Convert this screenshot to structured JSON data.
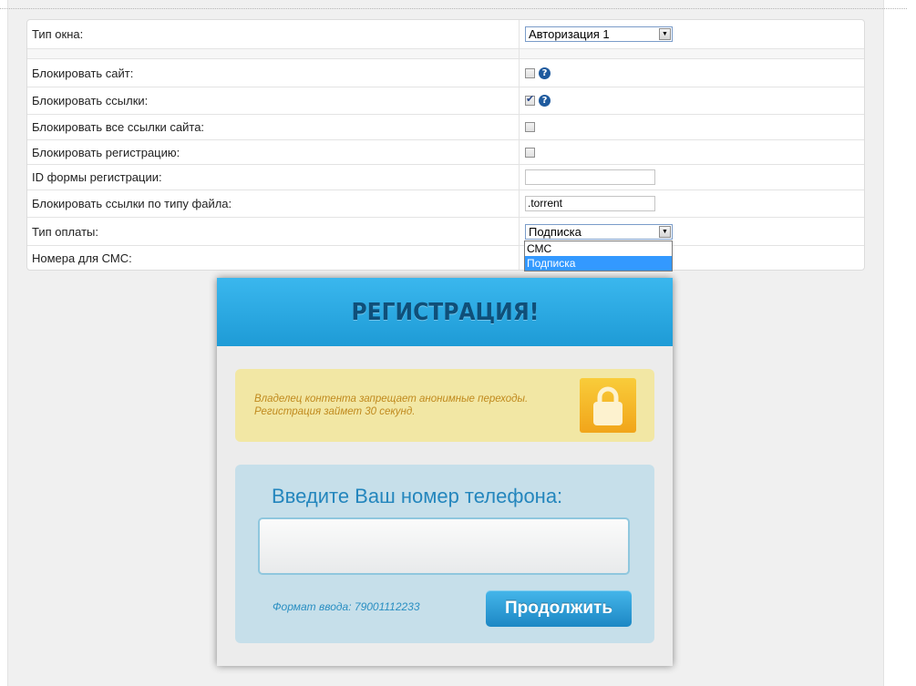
{
  "settings": {
    "rows": {
      "window_type": {
        "label": "Тип окна:",
        "value": "Авторизация 1"
      },
      "block_site": {
        "label": "Блокировать сайт:",
        "checked": false
      },
      "block_links": {
        "label": "Блокировать ссылки:",
        "checked": true
      },
      "block_all_links": {
        "label": "Блокировать все ссылки сайта:",
        "checked": false
      },
      "block_registration": {
        "label": "Блокировать регистрацию:",
        "checked": false
      },
      "reg_form_id": {
        "label": "ID формы регистрации:",
        "value": ""
      },
      "block_by_filetype": {
        "label": "Блокировать ссылки по типу файла:",
        "value": ".torrent"
      },
      "payment_type": {
        "label": "Тип оплаты:",
        "value": "Подписка"
      },
      "sms_numbers": {
        "label": "Номера для СМС:"
      }
    },
    "payment_options": [
      "СМС",
      "Подписка"
    ],
    "payment_selected_index": 1,
    "help_glyph": "?"
  },
  "registration": {
    "title": "РЕГИСТРАЦИЯ!",
    "warning_line1": "Владелец контента запрещает анонимные переходы.",
    "warning_line2": "Регистрация займет 30 секунд.",
    "phone_label": "Введите Ваш номер телефона:",
    "phone_value": "",
    "format_hint": "Формат ввода: 79001112233",
    "continue_label": "Продолжить"
  },
  "colors": {
    "header_blue": "#2aaae4",
    "title_color": "#0f4f79",
    "warning_bg": "#f2e7a4",
    "phone_box_bg": "#c6dfea",
    "button_blue": "#2b9bd6"
  }
}
